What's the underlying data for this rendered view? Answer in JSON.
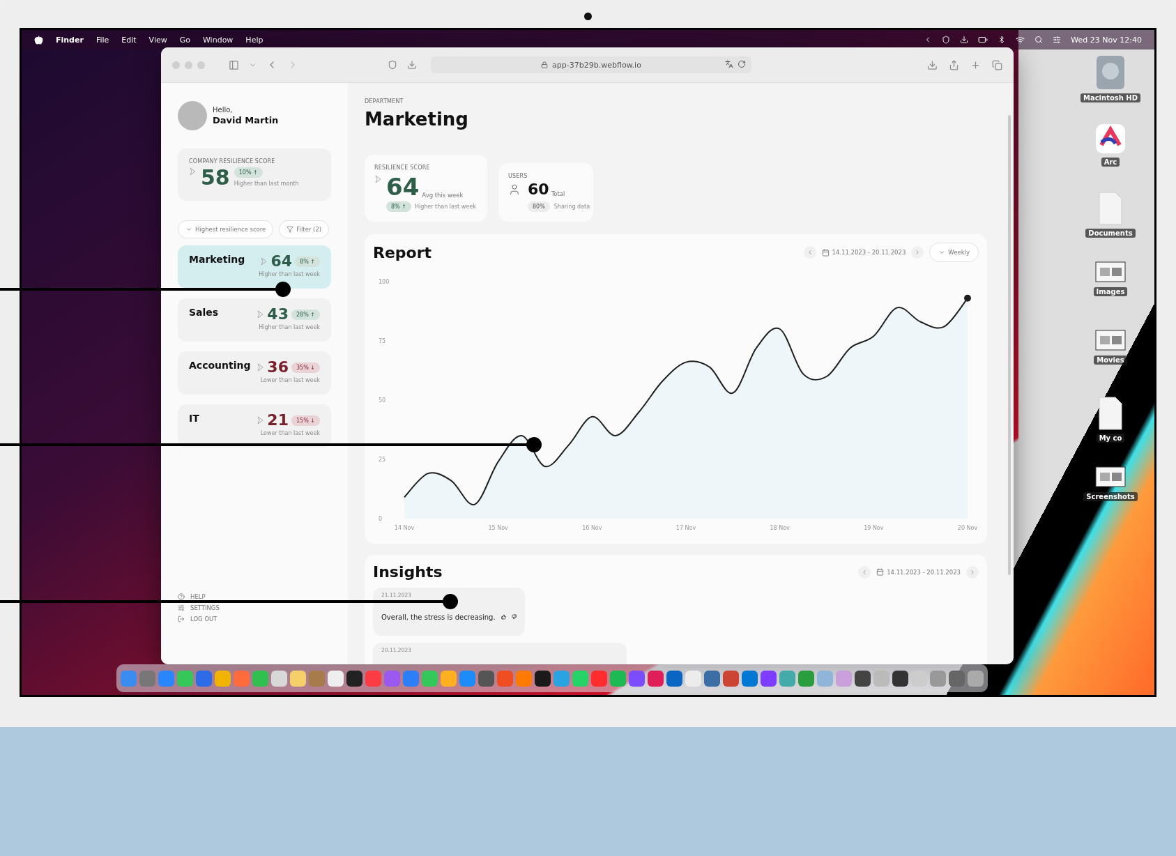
{
  "menu_bar": {
    "items": [
      "Finder",
      "File",
      "Edit",
      "View",
      "Go",
      "Window",
      "Help"
    ],
    "clock": "Wed 23 Nov  12:40"
  },
  "browser": {
    "url": "app-37b29b.webflow.io"
  },
  "sidebar": {
    "greeting": "Hello,",
    "user": "David Martin",
    "company_score": {
      "label": "COMPANY RESILIENCE SCORE",
      "value": "58",
      "change": "10% ↑",
      "note": "Higher than last month"
    },
    "sort": "Highest resilience score",
    "filter": "Filter (2)",
    "departments": [
      {
        "name": "Marketing",
        "score": "64",
        "change": "8% ↑",
        "note": "Higher than last week",
        "declining": false,
        "selected": true
      },
      {
        "name": "Sales",
        "score": "43",
        "change": "28% ↑",
        "note": "Higher than last week",
        "declining": false,
        "selected": false
      },
      {
        "name": "Accounting",
        "score": "36",
        "change": "35% ↓",
        "note": "Lower than last week",
        "declining": true,
        "selected": false
      },
      {
        "name": "IT",
        "score": "21",
        "change": "15% ↓",
        "note": "Lower than last week",
        "declining": true,
        "selected": false
      }
    ],
    "footer": [
      {
        "kind": "help",
        "label": "HELP"
      },
      {
        "kind": "settings",
        "label": "SETTINGS"
      },
      {
        "kind": "logout",
        "label": "LOG OUT"
      }
    ]
  },
  "department": {
    "label": "DEPARTMENT",
    "name": "Marketing"
  },
  "resilience": {
    "label": "RESILIENCE SCORE",
    "value": "64",
    "caption": "Avg this week",
    "change": "8% ↑",
    "note": "Higher than last week"
  },
  "users": {
    "label": "USERS",
    "value": "60",
    "caption": "Total",
    "share": "80%",
    "note": "Sharing data"
  },
  "report": {
    "title": "Report",
    "date_range": "14.11.2023 - 20.11.2023",
    "period": "Weekly",
    "chart_data": {
      "type": "area",
      "categories": [
        "14 Nov",
        null,
        null,
        null,
        "15 Nov",
        null,
        null,
        null,
        "16 Nov",
        null,
        null,
        null,
        "17 Nov",
        null,
        null,
        null,
        "18 Nov",
        null,
        null,
        null,
        "19 Nov",
        null,
        null,
        null,
        "20 Nov"
      ],
      "series": [
        {
          "color": "#1f1f1f",
          "values": [
            9,
            19,
            16,
            6,
            24,
            35,
            22,
            31,
            43,
            35,
            45,
            58,
            66,
            64,
            53,
            72,
            80,
            61,
            60,
            72,
            77,
            89,
            83,
            81,
            93
          ]
        }
      ],
      "ylim": [
        0,
        100
      ],
      "yticks": [
        0,
        25,
        50,
        75,
        100
      ]
    }
  },
  "insights": {
    "title": "Insights",
    "date_range": "14.11.2023 - 20.11.2023",
    "items": [
      {
        "date": "21.11.2023",
        "text": "Overall, the stress is decreasing."
      },
      {
        "date": "20.11.2023"
      }
    ]
  },
  "desktop_icons": [
    {
      "kind": "disk",
      "label": "Macintosh HD"
    },
    {
      "kind": "app",
      "label": "Arc"
    },
    {
      "kind": "file",
      "label": "Documents"
    },
    {
      "kind": "thumbnail",
      "label": "Images"
    },
    {
      "kind": "thumbnail",
      "label": "Movies"
    },
    {
      "kind": "file",
      "label": "My co"
    },
    {
      "kind": "thumbnail",
      "label": "Screenshots"
    }
  ]
}
